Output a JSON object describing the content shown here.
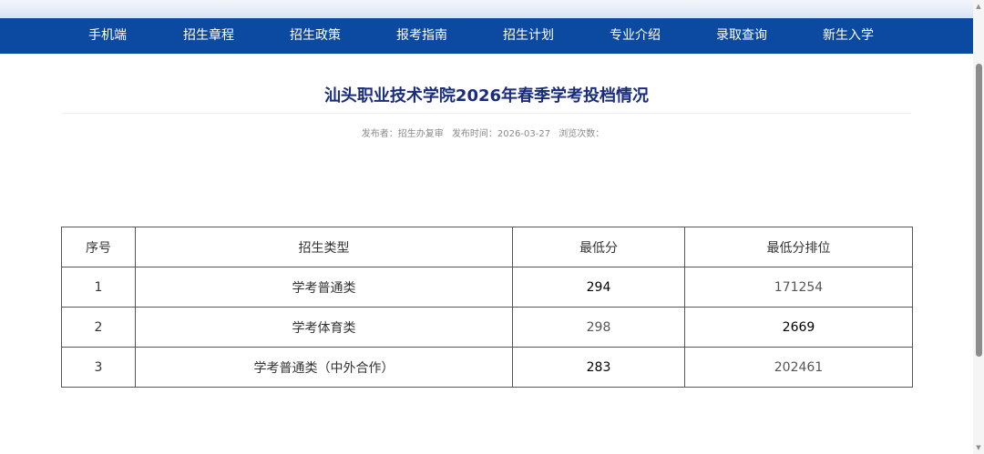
{
  "nav": {
    "items": [
      "手机端",
      "招生章程",
      "招生政策",
      "报考指南",
      "招生计划",
      "专业介绍",
      "录取查询",
      "新生入学"
    ]
  },
  "article": {
    "title": "汕头职业技术学院2026年春季学考投档情况",
    "publisher_label": "发布者：招生办复审",
    "publish_time_label": "发布时间：2026-03-27",
    "views_label": "浏览次数："
  },
  "table": {
    "headers": [
      "序号",
      "招生类型",
      "最低分",
      "最低分排位"
    ],
    "rows": [
      [
        "1",
        "学考普通类",
        "294",
        "171254"
      ],
      [
        "2",
        "学考体育类",
        "298",
        "2669"
      ],
      [
        "3",
        "学考普通类（中外合作）",
        "283",
        "202461"
      ]
    ]
  },
  "scrollbar": {
    "up_icon": "triangle-up-icon",
    "down_icon": "triangle-down-icon"
  },
  "colors": {
    "nav_bg": "#0b4aa0",
    "title": "#1a2d7a"
  }
}
